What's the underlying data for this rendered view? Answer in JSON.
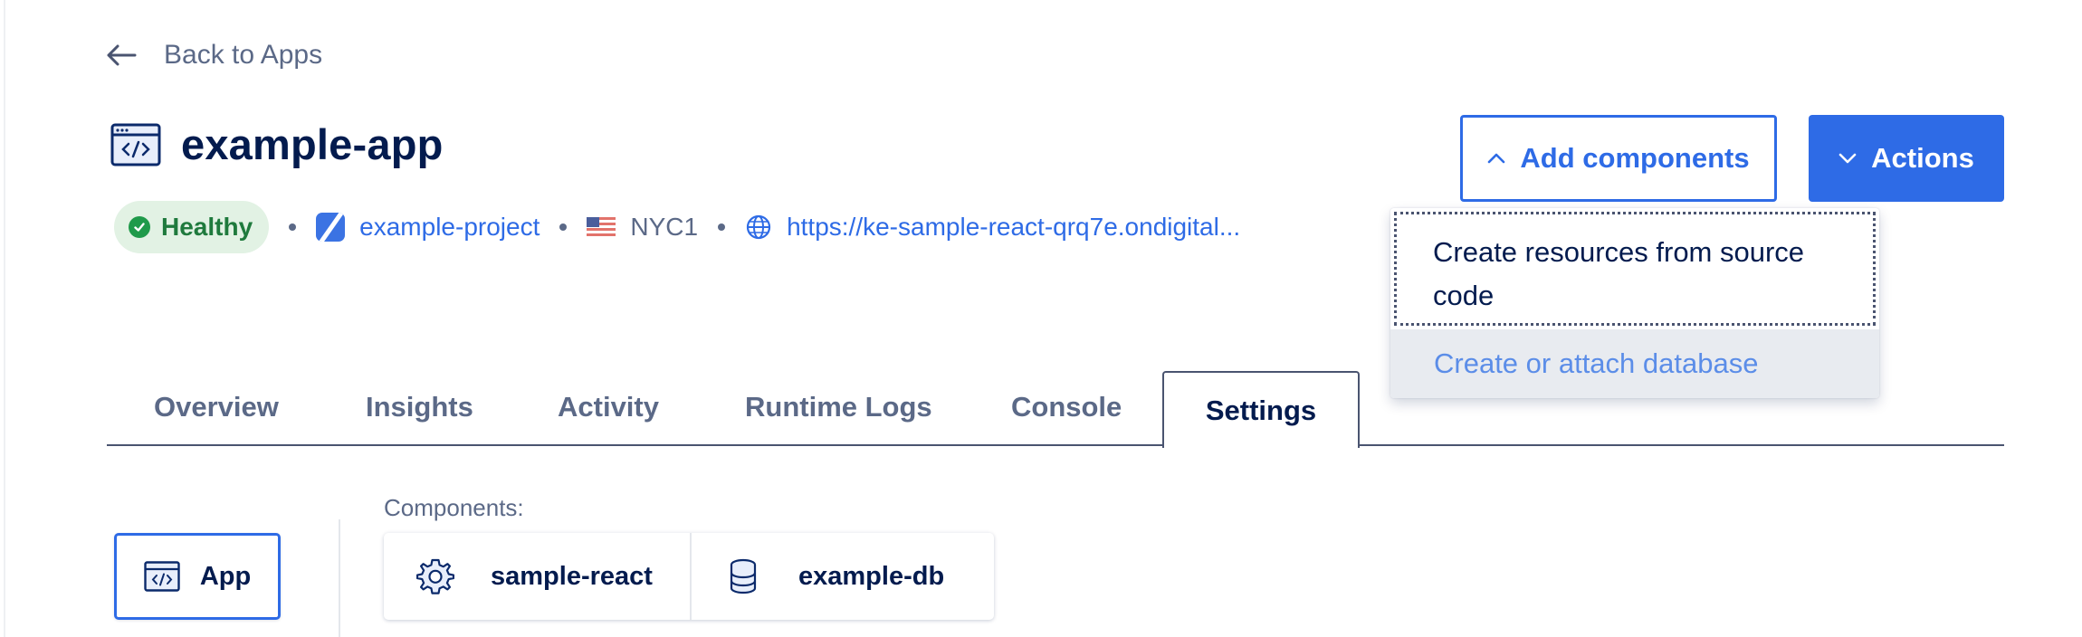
{
  "nav": {
    "back_label": "Back to Apps"
  },
  "app": {
    "name": "example-app",
    "status": "Healthy",
    "project": "example-project",
    "region": "NYC1",
    "url": "https://ke-sample-react-qrq7e.ondigital..."
  },
  "buttons": {
    "add_components": "Add components",
    "actions": "Actions"
  },
  "dropdown": {
    "items": [
      {
        "label_line1": "Create resources from source",
        "label_line2": "code"
      },
      {
        "label": "Create or attach database"
      }
    ]
  },
  "tabs": [
    {
      "label": "Overview"
    },
    {
      "label": "Insights"
    },
    {
      "label": "Activity"
    },
    {
      "label": "Runtime Logs"
    },
    {
      "label": "Console"
    },
    {
      "label": "Settings",
      "active": true
    }
  ],
  "settings": {
    "app_card_label": "App",
    "components_label": "Components:",
    "components": [
      {
        "name": "sample-react",
        "icon": "gear-icon"
      },
      {
        "name": "example-db",
        "icon": "database-icon"
      }
    ]
  },
  "colors": {
    "accent": "#2e6be6",
    "title": "#031b4e",
    "muted": "#5b6987",
    "healthy_bg": "#e2f2e4",
    "healthy_fg": "#1f9a4a"
  }
}
